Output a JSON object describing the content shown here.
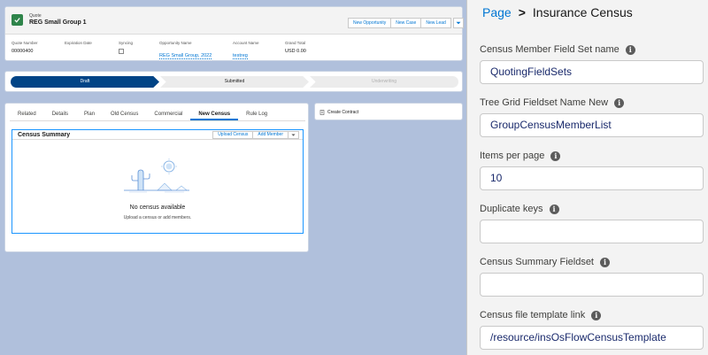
{
  "record": {
    "object_label": "Quote",
    "title": "REG Small Group 1",
    "actions": [
      "New Opportunity",
      "New Case",
      "New Lead"
    ],
    "fields": [
      {
        "label": "Quote Number",
        "value": "00000400"
      },
      {
        "label": "Expiration Date",
        "value": ""
      },
      {
        "label": "Syncing",
        "value": ""
      },
      {
        "label": "Opportunity Name",
        "value": "REG Small Group, 2022"
      },
      {
        "label": "Account Name",
        "value": "testreg"
      },
      {
        "label": "Grand Total",
        "value": "USD 0.00"
      }
    ]
  },
  "path": {
    "stages": [
      "Draft",
      "Submitted",
      "Underwriting"
    ],
    "current": "Draft"
  },
  "tabs": [
    "Related",
    "Details",
    "Plan",
    "Old Census",
    "Commercial",
    "New Census",
    "Rule Log"
  ],
  "active_tab": "New Census",
  "census": {
    "title": "Census Summary",
    "upload_label": "Upload Census",
    "add_label": "Add Member",
    "empty_title": "No census available",
    "empty_sub": "Upload a census or add members."
  },
  "contract": {
    "label": "Create Contract"
  },
  "panel": {
    "breadcrumb_root": "Page",
    "breadcrumb_sep": ">",
    "breadcrumb_current": "Insurance Census",
    "fields": [
      {
        "label": "Census Member Field Set name",
        "value": "QuotingFieldSets"
      },
      {
        "label": "Tree Grid Fieldset Name New",
        "value": "GroupCensusMemberList"
      },
      {
        "label": "Items per page",
        "value": "10"
      },
      {
        "label": "Duplicate keys",
        "value": ""
      },
      {
        "label": "Census Summary Fieldset",
        "value": ""
      },
      {
        "label": "Census file template link",
        "value": "/resource/insOsFlowCensusTemplate"
      }
    ]
  },
  "colors": {
    "canvas": "#b0c0dc",
    "brand": "#0176d3",
    "path_active": "#014486",
    "quote_icon": "#2e844a"
  }
}
